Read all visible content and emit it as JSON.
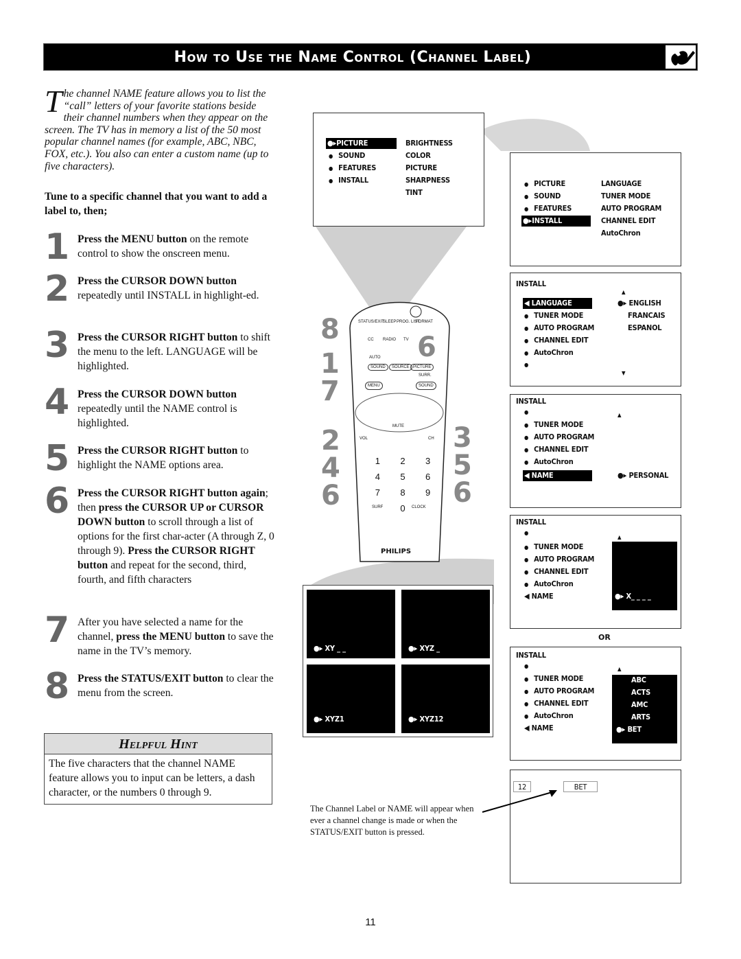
{
  "header": {
    "title": "How to Use the Name Control (Channel Label)",
    "icon": "wrench-icon"
  },
  "intro": {
    "drop_cap": "T",
    "text": "he channel NAME feature allows you to list the “call” letters of your favorite stations beside their channel numbers when they appear on the screen.  The TV has in memory a list of the 50 most popular channel names (for example, ABC, NBC, FOX, etc.).  You also can enter a custom name (up to five characters)."
  },
  "tune": "Tune to a specific channel that you want to add a label to, then;",
  "steps": [
    {
      "num": "1",
      "bold": "Press the MENU button",
      "rest": " on the remote control to show the onscreen menu."
    },
    {
      "num": "2",
      "bold": "Press the CURSOR DOWN button",
      "rest": " repeatedly until INSTALL in highlight-ed."
    },
    {
      "num": "3",
      "bold": "Press the CURSOR RIGHT button",
      "rest": " to shift the menu to the left. LANGUAGE will be highlighted."
    },
    {
      "num": "4",
      "bold": "Press the CURSOR DOWN button",
      "rest": " repeatedly until the NAME control is highlighted."
    },
    {
      "num": "5",
      "bold": "Press the CURSOR RIGHT button",
      "rest": " to highlight the NAME options area."
    },
    {
      "num": "6",
      "parts": [
        {
          "b": true,
          "t": "Press the CURSOR RIGHT button again"
        },
        {
          "b": false,
          "t": "; then "
        },
        {
          "b": true,
          "t": "press the CURSOR UP or CURSOR DOWN button"
        },
        {
          "b": false,
          "t": " to scroll through a list of options for the first char-acter (A through Z, 0 through 9).  "
        },
        {
          "b": true,
          "t": "Press the CURSOR RIGHT button"
        },
        {
          "b": false,
          "t": " and repeat for the second, third, fourth, and fifth characters"
        }
      ]
    },
    {
      "num": "7",
      "parts": [
        {
          "b": false,
          "t": "After you have selected a name for the channel, "
        },
        {
          "b": true,
          "t": "press the MENU button"
        },
        {
          "b": false,
          "t": " to save the name in the TV’s memory."
        }
      ]
    },
    {
      "num": "8",
      "bold": "Press the STATUS/EXIT button",
      "rest": " to clear the menu from the screen."
    }
  ],
  "hint": {
    "title": "Helpful Hint",
    "body": "The five characters that the channel NAME feature allows you to input can be letters, a dash character, or the numbers 0 through 9."
  },
  "screen1": {
    "left": [
      "PICTURE",
      "SOUND",
      "FEATURES",
      "INSTALL"
    ],
    "right": [
      "BRIGHTNESS",
      "COLOR",
      "PICTURE",
      "SHARPNESS",
      "TINT"
    ],
    "highlighted": "PICTURE"
  },
  "screen2": {
    "left": [
      "PICTURE",
      "SOUND",
      "FEATURES",
      "INSTALL"
    ],
    "right": [
      "LANGUAGE",
      "TUNER MODE",
      "AUTO PROGRAM",
      "CHANNEL EDIT",
      "AutoChron"
    ],
    "highlighted": "INSTALL"
  },
  "screen3": {
    "title": "INSTALL",
    "left": [
      "LANGUAGE",
      "TUNER MODE",
      "AUTO PROGRAM",
      "CHANNEL EDIT",
      "AutoChron"
    ],
    "right": [
      "ENGLISH",
      "FRANCAIS",
      "ESPANOL"
    ],
    "highlighted": "LANGUAGE"
  },
  "screen4": {
    "title": "INSTALL",
    "left": [
      "TUNER MODE",
      "AUTO PROGRAM",
      "CHANNEL EDIT",
      "AutoChron",
      "NAME"
    ],
    "value": "PERSONAL",
    "highlighted": "NAME"
  },
  "screen5": {
    "title": "INSTALL",
    "left": [
      "TUNER MODE",
      "AUTO PROGRAM",
      "CHANNEL EDIT",
      "AutoChron",
      "NAME"
    ],
    "value": "X_ _ _ _"
  },
  "or_label": "OR",
  "screen6": {
    "title": "INSTALL",
    "left": [
      "TUNER MODE",
      "AUTO PROGRAM",
      "CHANNEL EDIT",
      "AutoChron",
      "NAME"
    ],
    "options": [
      "ABC",
      "ACTS",
      "AMC",
      "ARTS",
      "BET"
    ],
    "selected": "BET"
  },
  "name_entries": [
    "XY _ _",
    "XYZ _",
    "XYZ1",
    "XYZ12"
  ],
  "screen7": {
    "channel": "12",
    "label": "BET"
  },
  "caption": "The Channel Label or NAME will appear when ever a channel change is made or when the STATUS/EXIT button is pressed.",
  "remote": {
    "brand": "PHILIPS",
    "buttons": [
      "STATUS/EXIT",
      "SLEEP",
      "PROG. LIST",
      "FORMAT",
      "CC",
      "RADIO",
      "TV",
      "AUTO",
      "SOUND",
      "SOURCE",
      "PICTURE",
      "MENU",
      "SURR.",
      "SOUND",
      "MUTE",
      "VOL",
      "CH",
      "SURF",
      "CLOCK"
    ],
    "digits": [
      "1",
      "2",
      "3",
      "4",
      "5",
      "6",
      "7",
      "8",
      "9",
      "0"
    ],
    "callouts": {
      "top_left": "8",
      "mid_left": "1\n7",
      "right_top": "6",
      "bottom_left": "2\n4\n6",
      "bottom_right": "3\n5\n6"
    }
  },
  "page_number": "11"
}
